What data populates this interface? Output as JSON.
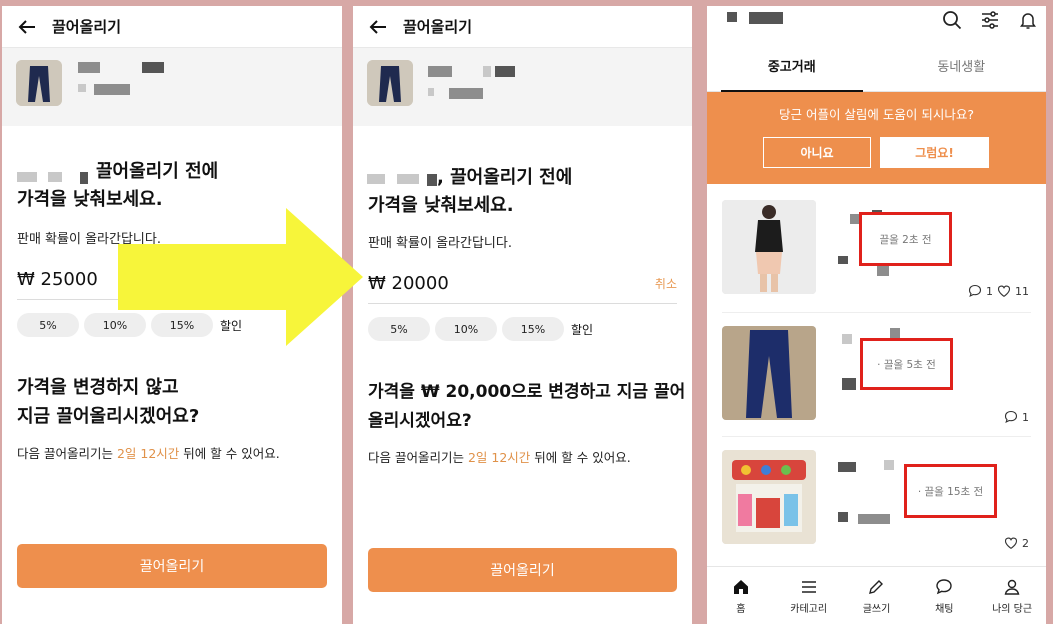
{
  "screen1": {
    "title": "끌어올리기",
    "heading_line1": "끌어올리기 전에",
    "heading_line2": "가격을 낮춰보세요.",
    "subtext": "판매 확률이 올라간답니다.",
    "price_value": "₩ 25000",
    "discounts": [
      "5%",
      "10%",
      "15%"
    ],
    "discount_suffix": "할인",
    "question_line1": "가격을 변경하지 않고",
    "question_line2": "지금 끌어올리시겠어요?",
    "note_prefix": "다음 끌어올리기는 ",
    "note_highlight": "2일 12시간",
    "note_suffix": " 뒤에 할 수 있어요.",
    "button_label": "끌어올리기"
  },
  "screen2": {
    "title": "끌어올리기",
    "heading_line1": ", 끌어올리기 전에",
    "heading_line2": "가격을 낮춰보세요.",
    "subtext": "판매 확률이 올라간답니다.",
    "price_value": "₩ 20000",
    "cancel_label": "취소",
    "discounts": [
      "5%",
      "10%",
      "15%"
    ],
    "discount_suffix": "할인",
    "question_line1": "가격을 ₩ 20,000으로 변경하고 지금 끌어",
    "question_line2": "올리시겠어요?",
    "note_prefix": "다음 끌어올리기는 ",
    "note_highlight": "2일 12시간",
    "note_suffix": " 뒤에 할 수 있어요.",
    "button_label": "끌어올리기"
  },
  "screen3": {
    "icons": [
      "search-icon",
      "filter-icon",
      "bell-icon"
    ],
    "tabs": [
      "중고거래",
      "동네생활"
    ],
    "banner_question": "당근 어플이 살림에 도움이 되시나요?",
    "banner_no": "아니요",
    "banner_yes": "그럼요!",
    "items": [
      {
        "bump": "끌올 2초 전",
        "comments": "1",
        "likes": "11"
      },
      {
        "bump": "· 끌올 5초 전",
        "comments": "1"
      },
      {
        "bump": "· 끌올 15초 전",
        "likes": "2"
      }
    ],
    "nav": [
      "홈",
      "카테고리",
      "글쓰기",
      "채팅",
      "나의 당근"
    ]
  },
  "colors": {
    "accent": "#ee8f4d",
    "highlight_box": "#e0211b",
    "arrow": "#f7f53a",
    "background": "#d7a8a6"
  }
}
